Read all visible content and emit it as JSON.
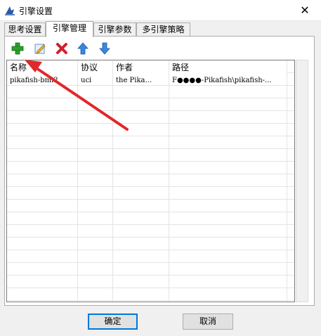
{
  "window": {
    "title": "引擎设置",
    "close_label": "✕"
  },
  "tabs": [
    {
      "label": "思考设置",
      "active": false
    },
    {
      "label": "引擎管理",
      "active": true
    },
    {
      "label": "引擎参数",
      "active": false
    },
    {
      "label": "多引擎策略",
      "active": false
    }
  ],
  "toolbar": {
    "buttons": [
      {
        "name": "add-engine-icon",
        "icon": "green-plus"
      },
      {
        "name": "edit-engine-icon",
        "icon": "pencil"
      },
      {
        "name": "delete-engine-icon",
        "icon": "red-x"
      },
      {
        "name": "move-up-icon",
        "icon": "blue-up-arrow"
      },
      {
        "name": "move-down-icon",
        "icon": "blue-down-arrow"
      }
    ]
  },
  "table": {
    "columns": [
      "名称",
      "协议",
      "作者",
      "路径"
    ],
    "rows": [
      [
        "pikafish-bmi2",
        "uci",
        "the Pika...",
        "F●●●●-Pikafish\\pikafish-..."
      ]
    ]
  },
  "buttons": {
    "ok": "确定",
    "cancel": "取消"
  },
  "colors": {
    "accent": "#0078d7",
    "arrow": "#e0282b",
    "plus": "#2aa12a"
  }
}
